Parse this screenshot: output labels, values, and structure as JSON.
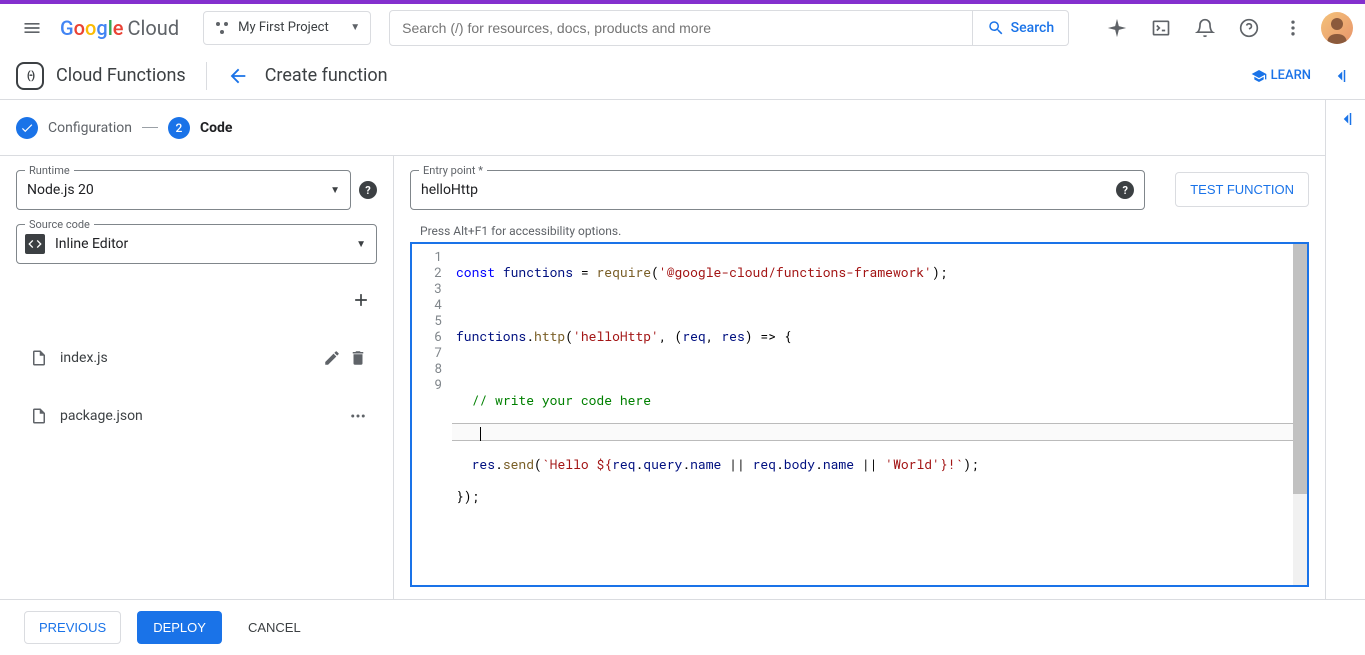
{
  "header": {
    "logo_text": "Google",
    "logo_suffix": "Cloud",
    "project_name": "My First Project",
    "search_placeholder": "Search (/) for resources, docs, products and more",
    "search_button": "Search"
  },
  "subheader": {
    "product": "Cloud Functions",
    "page_title": "Create function",
    "learn": "LEARN"
  },
  "stepper": {
    "step1_label": "Configuration",
    "step2_num": "2",
    "step2_label": "Code"
  },
  "config": {
    "runtime_label": "Runtime",
    "runtime_value": "Node.js 20",
    "source_label": "Source code",
    "source_value": "Inline Editor",
    "entry_label": "Entry point *",
    "entry_value": "helloHttp",
    "test_button": "TEST FUNCTION"
  },
  "files": {
    "items": [
      {
        "name": "index.js",
        "actions": "edit-delete"
      },
      {
        "name": "package.json",
        "actions": "more"
      }
    ]
  },
  "editor": {
    "a11y": "Press Alt+F1 for accessibility options.",
    "lines": [
      "1",
      "2",
      "3",
      "4",
      "5",
      "6",
      "7",
      "8",
      "9"
    ],
    "code_raw": "const functions = require('@google-cloud/functions-framework');\n\nfunctions.http('helloHttp', (req, res) => {\n\n  // write your code here\n\n  res.send(`Hello ${req.query.name || req.body.name || 'World'}!`);\n});\n"
  },
  "footer": {
    "previous": "PREVIOUS",
    "deploy": "DEPLOY",
    "cancel": "CANCEL"
  }
}
